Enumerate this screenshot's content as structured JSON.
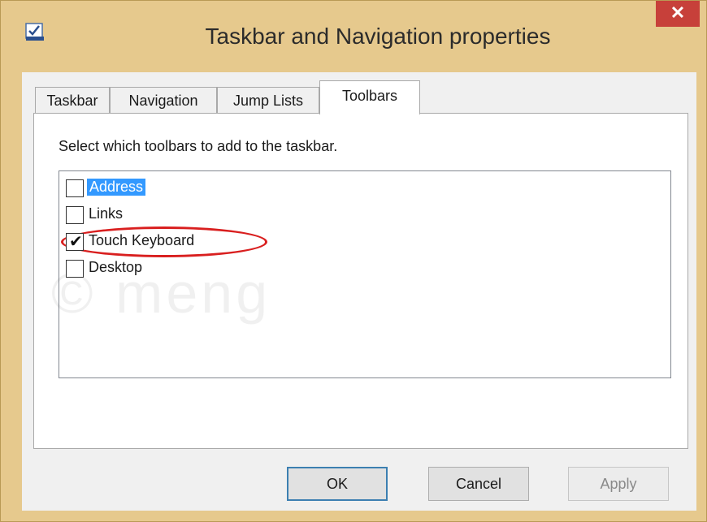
{
  "window": {
    "title": "Taskbar and Navigation properties",
    "close_label": "✕",
    "app_icon": "taskbar-properties-icon",
    "accent_color": "#e6c98d",
    "close_color": "#c7403a"
  },
  "tabs": [
    {
      "label": "Taskbar",
      "active": false
    },
    {
      "label": "Navigation",
      "active": false
    },
    {
      "label": "Jump Lists",
      "active": false
    },
    {
      "label": "Toolbars",
      "active": true
    }
  ],
  "toolbars_panel": {
    "instruction": "Select which toolbars to add to the taskbar.",
    "items": [
      {
        "label": "Address",
        "checked": false,
        "selected": true
      },
      {
        "label": "Links",
        "checked": false,
        "selected": false
      },
      {
        "label": "Touch Keyboard",
        "checked": true,
        "selected": false,
        "highlighted": true
      },
      {
        "label": "Desktop",
        "checked": false,
        "selected": false
      }
    ]
  },
  "buttons": {
    "ok": "OK",
    "cancel": "Cancel",
    "apply": "Apply"
  }
}
